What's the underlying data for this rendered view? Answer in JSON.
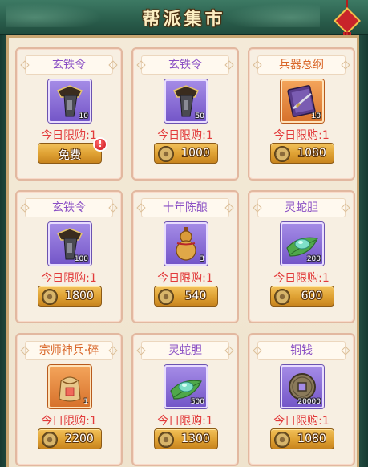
{
  "header": {
    "title": "帮派集市"
  },
  "items": [
    {
      "name": "玄铁令",
      "count": "10",
      "limit": "今日限购:1",
      "price": "免费",
      "free": true,
      "icon": "iron-token-icon",
      "rarity": "purple"
    },
    {
      "name": "玄铁令",
      "count": "50",
      "limit": "今日限购:1",
      "price": "1000",
      "free": false,
      "icon": "iron-token-icon",
      "rarity": "purple"
    },
    {
      "name": "兵器总纲",
      "count": "10",
      "limit": "今日限购:1",
      "price": "1080",
      "free": false,
      "icon": "weapon-manual-icon",
      "rarity": "orange"
    },
    {
      "name": "玄铁令",
      "count": "100",
      "limit": "今日限购:1",
      "price": "1800",
      "free": false,
      "icon": "iron-token-icon",
      "rarity": "purple"
    },
    {
      "name": "十年陈酿",
      "count": "3",
      "limit": "今日限购:1",
      "price": "540",
      "free": false,
      "icon": "wine-gourd-icon",
      "rarity": "purple"
    },
    {
      "name": "灵蛇胆",
      "count": "200",
      "limit": "今日限购:1",
      "price": "600",
      "free": false,
      "icon": "snake-gall-icon",
      "rarity": "purple"
    },
    {
      "name": "宗师神兵·碎",
      "count": "1",
      "limit": "今日限购:1",
      "price": "2200",
      "free": false,
      "icon": "master-weapon-shard-icon",
      "rarity": "orange"
    },
    {
      "name": "灵蛇胆",
      "count": "500",
      "limit": "今日限购:1",
      "price": "1300",
      "free": false,
      "icon": "snake-gall-icon",
      "rarity": "purple"
    },
    {
      "name": "铜钱",
      "count": "20000",
      "limit": "今日限购:1",
      "price": "1080",
      "free": false,
      "icon": "copper-coin-icon",
      "rarity": "purple"
    }
  ],
  "colors": {
    "purple_name": "#8a4fc4",
    "orange_name": "#d9672a",
    "limit_red": "#e23a3a",
    "button_gold": "#dea032"
  }
}
